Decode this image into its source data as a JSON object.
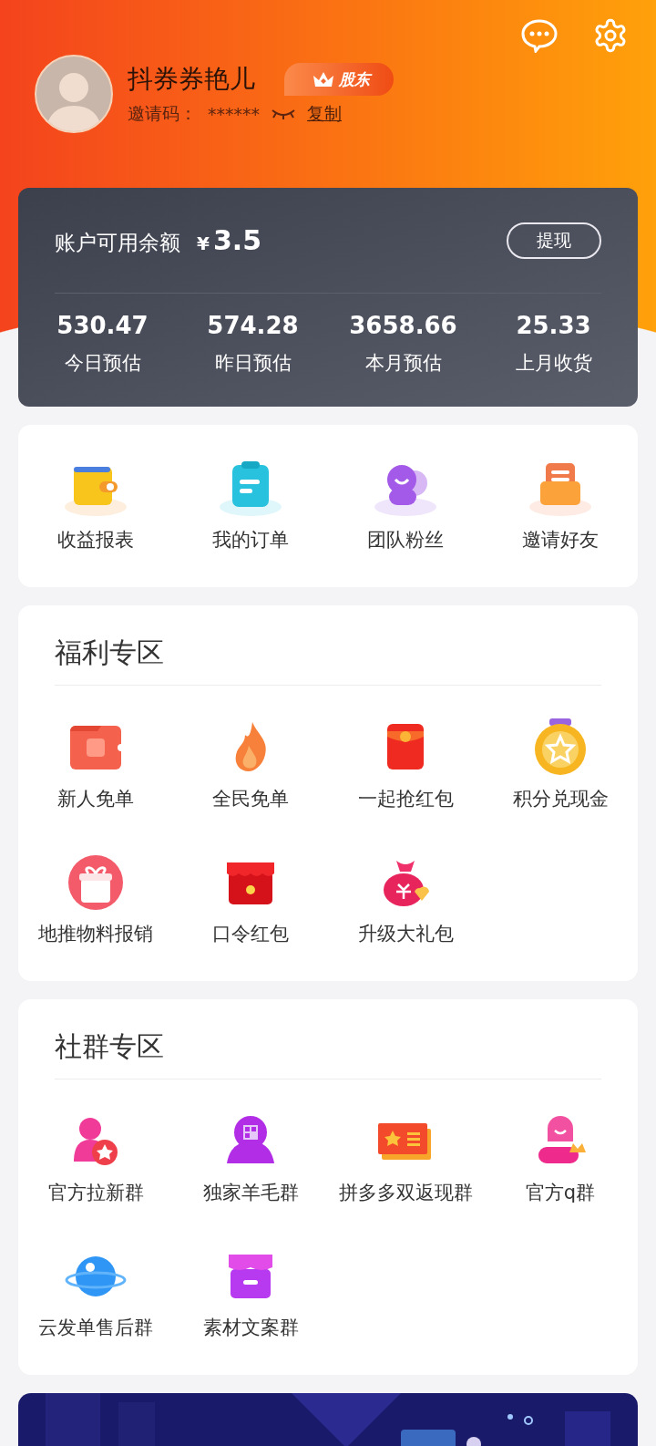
{
  "header": {
    "name": "抖券券艳儿",
    "badge": "股东",
    "invite_label": "邀请码：",
    "invite_code": "******",
    "copy_link": "复制"
  },
  "balance": {
    "label": "账户可用余额",
    "currency": "¥",
    "amount": "3.5",
    "withdraw_button": "提现",
    "stats": [
      {
        "value": "530.47",
        "label": "今日预估"
      },
      {
        "value": "574.28",
        "label": "昨日预估"
      },
      {
        "value": "3658.66",
        "label": "本月预估"
      },
      {
        "value": "25.33",
        "label": "上月收货"
      }
    ]
  },
  "shortcuts": [
    "收益报表",
    "我的订单",
    "团队粉丝",
    "邀请好友"
  ],
  "sections": [
    {
      "title": "福利专区",
      "items": [
        "新人免单",
        "全民免单",
        "一起抢红包",
        "积分兑现金",
        "地推物料报销",
        "口令红包",
        "升级大礼包"
      ]
    },
    {
      "title": "社群专区",
      "items": [
        "官方拉新群",
        "独家羊毛群",
        "拼多多双返现群",
        "官方q群",
        "云发单售后群",
        "素材文案群"
      ]
    }
  ]
}
